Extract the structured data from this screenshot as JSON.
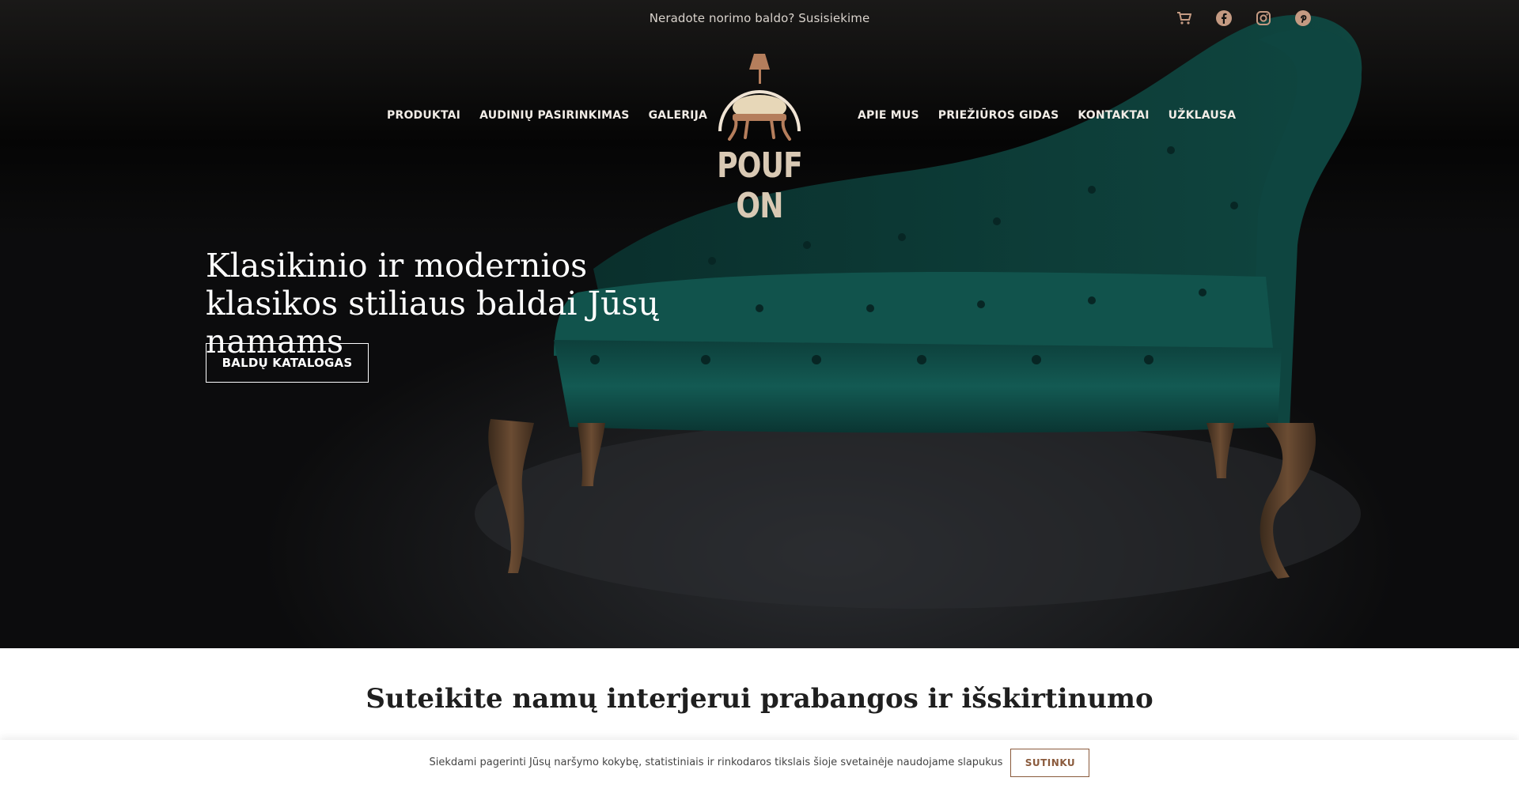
{
  "topbar": {
    "text": "Neradote norimo baldo? Susisiekime"
  },
  "icons": {
    "cart": "cart-icon",
    "facebook": "facebook-icon",
    "instagram": "instagram-icon",
    "pinterest": "pinterest-icon"
  },
  "colors": {
    "accent": "#c49a82",
    "logo": "#d9c9b4",
    "button_border": "#8a5a3c",
    "sofa": "#0f4a45"
  },
  "nav": {
    "left": [
      "PRODUKTAI",
      "AUDINIŲ PASIRINKIMAS",
      "GALERIJA"
    ],
    "right": [
      "APIE MUS",
      "PRIEŽIŪROS GIDAS",
      "KONTAKTAI",
      "UŽKLAUSA"
    ]
  },
  "logo": {
    "text": "POUF ON"
  },
  "hero": {
    "title": "Klasikinio ir modernios klasikos stiliaus baldai Jūsų namams",
    "button": "BALDŲ KATALOGAS"
  },
  "section": {
    "title": "Suteikite namų interjerui prabangos ir išskirtinumo"
  },
  "cookie": {
    "text": "Siekdami pagerinti Jūsų naršymo kokybę, statistiniais ir rinkodaros tikslais šioje svetainėje naudojame slapukus",
    "button": "SUTINKU"
  }
}
